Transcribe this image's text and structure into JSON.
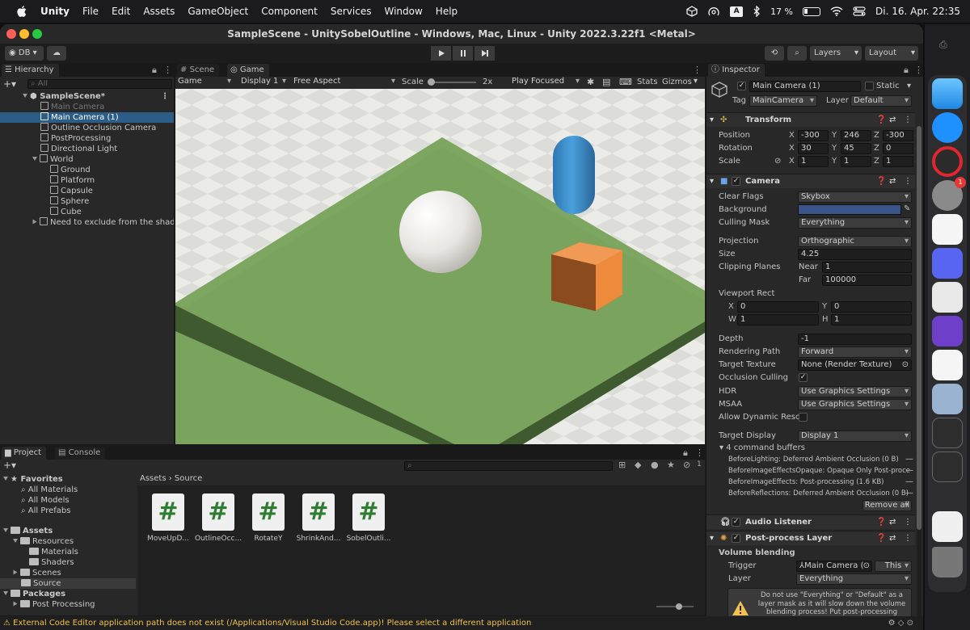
{
  "menubar": {
    "app_name": "Unity",
    "menus": [
      "File",
      "Edit",
      "Assets",
      "GameObject",
      "Component",
      "Services",
      "Window",
      "Help"
    ],
    "input_indicator": "A",
    "battery": "17 %",
    "datetime": "Di. 16. Apr.  22:35"
  },
  "window": {
    "title": "SampleScene - UnitySobelOutline - Windows, Mac, Linux - Unity 2022.3.22f1 <Metal>"
  },
  "toolbar": {
    "account": "DB",
    "layers": "Layers",
    "layout": "Layout"
  },
  "hierarchy": {
    "tab": "Hierarchy",
    "search_placeholder": "All",
    "scene": "SampleScene*",
    "items": [
      {
        "label": "Main Camera",
        "depth": 1,
        "dim": true
      },
      {
        "label": "Main Camera (1)",
        "depth": 1,
        "selected": true
      },
      {
        "label": "Outline Occlusion Camera",
        "depth": 1
      },
      {
        "label": "PostProcessing",
        "depth": 1
      },
      {
        "label": "Directional Light",
        "depth": 1
      },
      {
        "label": "World",
        "depth": 1
      },
      {
        "label": "Ground",
        "depth": 2
      },
      {
        "label": "Platform",
        "depth": 2
      },
      {
        "label": "Capsule",
        "depth": 2
      },
      {
        "label": "Sphere",
        "depth": 2
      },
      {
        "label": "Cube",
        "depth": 2
      },
      {
        "label": "Need to exclude from the shader?",
        "depth": 1
      }
    ]
  },
  "game_view": {
    "tabs": [
      "Scene",
      "Game"
    ],
    "mode": "Game",
    "display": "Display 1",
    "aspect": "Free Aspect",
    "scale_label": "Scale",
    "scale_value": "2x",
    "play_focus": "Play Focused",
    "stats": "Stats",
    "gizmos": "Gizmos"
  },
  "inspector": {
    "tab": "Inspector",
    "object_name": "Main Camera (1)",
    "static_label": "Static",
    "tag_label": "Tag",
    "tag_value": "MainCamera",
    "layer_label": "Layer",
    "layer_value": "Default",
    "transform": {
      "title": "Transform",
      "position_label": "Position",
      "position": [
        "-300",
        "246",
        "-300"
      ],
      "rotation_label": "Rotation",
      "rotation": [
        "30",
        "45",
        "0"
      ],
      "scale_label": "Scale",
      "scale": [
        "1",
        "1",
        "1"
      ]
    },
    "camera": {
      "title": "Camera",
      "clear_flags_label": "Clear Flags",
      "clear_flags": "Skybox",
      "background_label": "Background",
      "background_color": "#3a5389",
      "culling_mask_label": "Culling Mask",
      "culling_mask": "Everything",
      "projection_label": "Projection",
      "projection": "Orthographic",
      "size_label": "Size",
      "size": "4.25",
      "clipping_label": "Clipping Planes",
      "near_label": "Near",
      "near": "1",
      "far_label": "Far",
      "far": "100000",
      "viewport_label": "Viewport Rect",
      "vx": "0",
      "vy": "0",
      "vw": "1",
      "vh": "1",
      "depth_label": "Depth",
      "depth": "-1",
      "render_path_label": "Rendering Path",
      "render_path": "Forward",
      "target_texture_label": "Target Texture",
      "target_texture": "None (Render Texture)",
      "occlusion_label": "Occlusion Culling",
      "hdr_label": "HDR",
      "hdr": "Use Graphics Settings",
      "msaa_label": "MSAA",
      "msaa": "Use Graphics Settings",
      "dyn_res_label": "Allow Dynamic Resol",
      "target_display_label": "Target Display",
      "target_display": "Display 1",
      "cmd_buffers_label": "4 command buffers",
      "cmd_buffers": [
        "BeforeLighting: Deferred Ambient Occlusion (0 B)",
        "BeforeImageEffectsOpaque: Opaque Only Post-proce",
        "BeforeImageEffects: Post-processing (1.6 KB)",
        "BeforeReflections: Deferred Ambient Occlusion (0 B)"
      ],
      "remove_all": "Remove all"
    },
    "audio_listener": "Audio Listener",
    "post_layer": {
      "title": "Post-process Layer",
      "volume_blending": "Volume blending",
      "trigger_label": "Trigger",
      "trigger": "Main Camera (",
      "this_button": "This",
      "layer_label": "Layer",
      "layer": "Everything",
      "warning": "Do not use \"Everything\" or \"Default\" as a layer mask as it will slow down the volume blending process! Put post-processing volumes in their"
    }
  },
  "project": {
    "tabs": [
      "Project",
      "Console"
    ],
    "favorites": "Favorites",
    "fav_items": [
      "All Materials",
      "All Models",
      "All Prefabs"
    ],
    "assets": "Assets",
    "asset_tree": [
      {
        "label": "Resources",
        "depth": 1
      },
      {
        "label": "Materials",
        "depth": 2
      },
      {
        "label": "Shaders",
        "depth": 2
      },
      {
        "label": "Scenes",
        "depth": 1
      },
      {
        "label": "Source",
        "depth": 1,
        "selected": true
      }
    ],
    "packages": "Packages",
    "package_items": [
      "Post Processing"
    ],
    "breadcrumb": [
      "Assets",
      "Source"
    ],
    "files": [
      "MoveUpD...",
      "OutlineOcc...",
      "RotateY",
      "ShrinkAnd...",
      "SobelOutli..."
    ],
    "hidden_count": "1"
  },
  "status": {
    "message": "External Code Editor application path does not exist (/Applications/Visual Studio Code.app)! Please select a different application"
  },
  "colors": {
    "selection": "#2c5d87",
    "ground": "#7aa35d",
    "ground_side": "#3f5a2e",
    "capsule": "#3f8ecc",
    "cube": "#ee8a3c",
    "sphere": "#ececec"
  }
}
